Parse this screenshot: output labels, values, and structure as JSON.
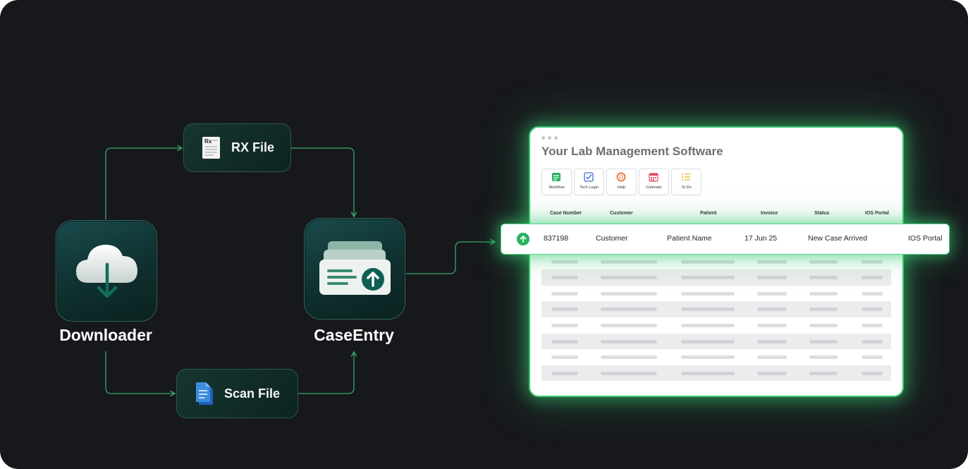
{
  "flow": {
    "downloader_label": "Downloader",
    "caseentry_label": "CaseEntry",
    "rx_file_label": "RX File",
    "scan_file_label": "Scan File",
    "rx_icon_text": "Rx"
  },
  "icons": {
    "downloader": "cloud-download-icon",
    "caseentry": "upload-cards-icon",
    "rx_file": "rx-document-icon",
    "scan_file": "scan-document-icon"
  },
  "colors": {
    "background": "#17181c",
    "accent_green": "#39c76f",
    "node_fill": "#163630",
    "connector": "#37a86c"
  },
  "lab_software": {
    "title": "Your Lab Management Software",
    "toolbar": [
      {
        "label": "Workflow",
        "icon": "workflow-icon",
        "color": "#27b15e"
      },
      {
        "label": "Tech Login",
        "icon": "checkbox-icon",
        "color": "#3b6fd6"
      },
      {
        "label": "Help",
        "icon": "lifebuoy-icon",
        "color": "#ef7b3a"
      },
      {
        "label": "Calendar",
        "icon": "calendar-icon",
        "color": "#e2455a"
      },
      {
        "label": "To Do",
        "icon": "checklist-icon",
        "color": "#e6b422"
      }
    ],
    "columns": [
      "Case Number",
      "Customer",
      "Patient",
      "Invoice",
      "Status",
      "IOS Portal"
    ],
    "highlighted_row": {
      "icon": "arrow-up-circle-icon",
      "case_number": "837198",
      "customer": "Customer",
      "patient": "Patient Name",
      "invoice": "17 Jun 25",
      "status": "New Case Arrived",
      "portal": "IOS Portal"
    }
  }
}
